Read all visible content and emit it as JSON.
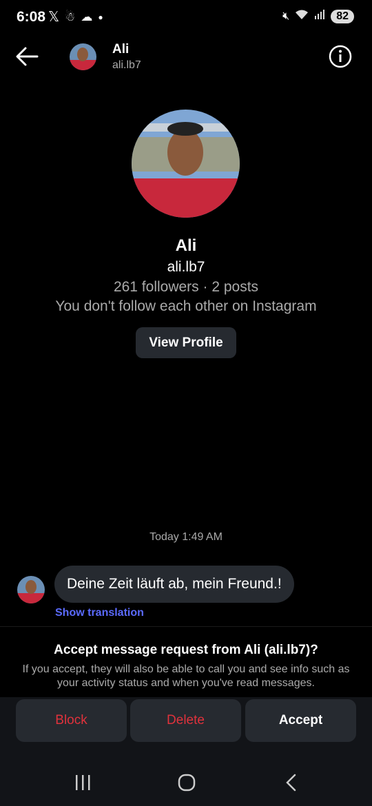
{
  "status_bar": {
    "time": "6:08",
    "battery": "82"
  },
  "header": {
    "name": "Ali",
    "username": "ali.lb7"
  },
  "profile": {
    "name": "Ali",
    "username": "ali.lb7",
    "stats": "261 followers · 2 posts",
    "relation": "You don't follow each other on Instagram",
    "view_profile_label": "View Profile"
  },
  "conversation": {
    "timestamp": "Today 1:49 AM",
    "message": "Deine Zeit läuft ab, mein Freund.!",
    "show_translation": "Show translation"
  },
  "request": {
    "title": "Accept message request from Ali (ali.lb7)?",
    "description": "If you accept, they will also be able to call you and see info such as your activity status and when you've read messages."
  },
  "actions": {
    "block": "Block",
    "delete": "Delete",
    "accept": "Accept"
  },
  "colors": {
    "danger": "#e0323c",
    "link": "#5b6bff",
    "surface": "#262a30"
  }
}
